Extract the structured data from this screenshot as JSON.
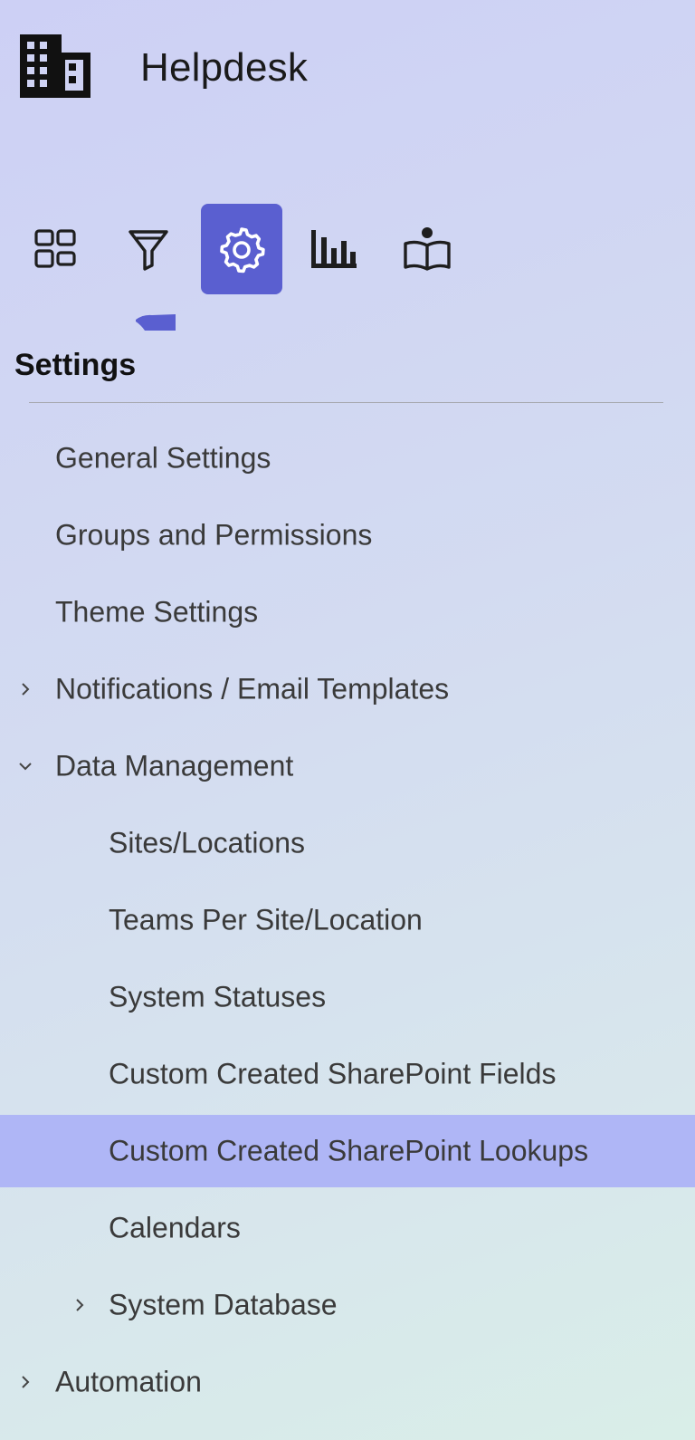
{
  "app": {
    "title": "Helpdesk"
  },
  "toolbar": {
    "buttons": [
      {
        "icon": "grid-dashboard-icon",
        "active": false
      },
      {
        "icon": "filter-funnel-icon",
        "active": false
      },
      {
        "icon": "gear-icon",
        "active": true
      },
      {
        "icon": "bar-chart-icon",
        "active": false
      },
      {
        "icon": "book-reader-icon",
        "active": false
      }
    ],
    "accent_color": "#5a5fd0"
  },
  "section": {
    "title": "Settings"
  },
  "nav": {
    "items": [
      {
        "label": "General Settings",
        "level": 0,
        "chevron": "none",
        "selected": false
      },
      {
        "label": "Groups and Permissions",
        "level": 0,
        "chevron": "none",
        "selected": false
      },
      {
        "label": "Theme Settings",
        "level": 0,
        "chevron": "none",
        "selected": false
      },
      {
        "label": "Notifications / Email Templates",
        "level": 0,
        "chevron": "collapsed",
        "selected": false
      },
      {
        "label": "Data Management",
        "level": 0,
        "chevron": "expanded",
        "selected": false
      },
      {
        "label": "Sites/Locations",
        "level": 1,
        "chevron": "none",
        "selected": false
      },
      {
        "label": "Teams Per Site/Location",
        "level": 1,
        "chevron": "none",
        "selected": false
      },
      {
        "label": "System Statuses",
        "level": 1,
        "chevron": "none",
        "selected": false
      },
      {
        "label": "Custom Created SharePoint Fields",
        "level": 1,
        "chevron": "none",
        "selected": false
      },
      {
        "label": "Custom Created SharePoint Lookups",
        "level": 1,
        "chevron": "none",
        "selected": true
      },
      {
        "label": "Calendars",
        "level": 1,
        "chevron": "none",
        "selected": false
      },
      {
        "label": "System Database",
        "level": 1,
        "chevron": "collapsed",
        "selected": false
      },
      {
        "label": "Automation",
        "level": 0,
        "chevron": "collapsed",
        "selected": false
      }
    ],
    "selected_color": "#afb6f6"
  }
}
